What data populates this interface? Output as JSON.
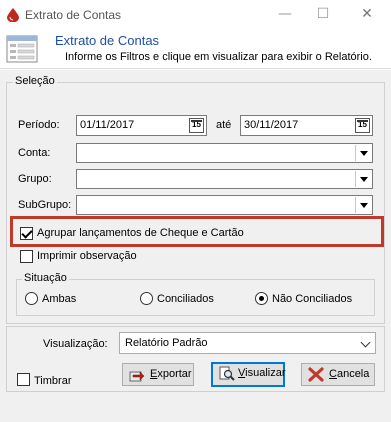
{
  "window": {
    "title": "Extrato de Contas",
    "minimize_glyph": "—",
    "maximize_glyph": "☐",
    "close_glyph": "✕"
  },
  "header": {
    "title": "Extrato de Contas",
    "subtitle": "Informe os Filtros e clique em visualizar para exibir o Relatório."
  },
  "selecao": {
    "legend": "Seleção",
    "periodo_label": "Período:",
    "periodo_inicio": "01/11/2017",
    "ate_label": "até",
    "periodo_fim": "30/11/2017",
    "calendar_glyph": "15",
    "conta_label": "Conta:",
    "conta_value": "",
    "grupo_label": "Grupo:",
    "grupo_value": "",
    "subgrupo_label": "SubGrupo:",
    "subgrupo_value": "",
    "agrupar_label": "Agrupar lançamentos de Cheque e Cartão",
    "agrupar_checked": true,
    "imprimir_label": "Imprimir observação",
    "imprimir_checked": false
  },
  "situacao": {
    "legend": "Situação",
    "options": [
      "Ambas",
      "Conciliados",
      "Não Conciliados"
    ],
    "selected": "Não Conciliados"
  },
  "bottom": {
    "visualizacao_label": "Visualização:",
    "visualizacao_value": "Relatório Padrão",
    "timbrar_label": "Timbrar",
    "timbrar_checked": false,
    "exportar_first": "E",
    "exportar_rest": "xportar",
    "visualizar_first": "V",
    "visualizar_rest": "isualizar",
    "cancelar_first": "C",
    "cancelar_rest": "ancela"
  },
  "colors": {
    "header_title": "#1d4fa0",
    "highlight": "#c0392b",
    "default_button_border": "#0078d7",
    "cancel_icon": "#c0392b"
  }
}
